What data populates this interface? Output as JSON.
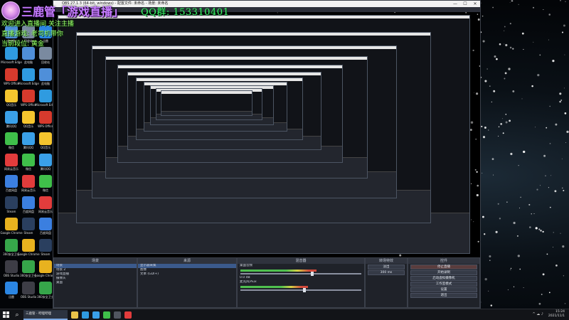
{
  "overlay": {
    "title": "三鹿管「游戏直播」",
    "qq_number": "QQ群: 153310401",
    "lines": [
      "欢迎进入直播间 关注主播",
      "直播游戏: 老司机带你",
      "当前段位: 黄金"
    ]
  },
  "desktop_icons": [
    {
      "label": "此电脑",
      "color": "#4f8fd9"
    },
    {
      "label": "Microsoft Edge",
      "color": "#2f9be0"
    },
    {
      "label": "WPS Office",
      "color": "#d63a2d"
    },
    {
      "label": "QQ音乐",
      "color": "#f5c52e"
    },
    {
      "label": "腾讯QQ",
      "color": "#3aa0e8"
    },
    {
      "label": "微信",
      "color": "#3fbf4a"
    },
    {
      "label": "网易云音乐",
      "color": "#e23c3c"
    },
    {
      "label": "百度网盘",
      "color": "#3b7fe0"
    },
    {
      "label": "Steam",
      "color": "#2a3f5f"
    },
    {
      "label": "Google Chrome",
      "color": "#e8b21f"
    },
    {
      "label": "360安全卫士",
      "color": "#36a64a"
    },
    {
      "label": "OBS Studio",
      "color": "#3d3d46"
    },
    {
      "label": "迅雷",
      "color": "#2b86e3"
    },
    {
      "label": "回收站",
      "color": "#7a8aa0"
    }
  ],
  "obs": {
    "window_title": "OBS 27.1.3 (64-bit, windows) - 配置文件: 未命名 - 场景: 未命名",
    "window_controls": {
      "minimize": "—",
      "maximize": "☐",
      "close": "✕"
    },
    "docks": {
      "scenes": {
        "header": "场景",
        "items": [
          "场景",
          "场景 2",
          "游戏直播",
          "摄像头",
          "桌面"
        ]
      },
      "sources": {
        "header": "来源",
        "items": [
          "显示器采集",
          "图像",
          "文本 (GDI+)"
        ]
      },
      "mixer": {
        "header": "混音器",
        "channels": [
          {
            "name": "桌面音频",
            "db": "0.0 dB",
            "level": 0.62
          },
          {
            "name": "麦克风/Aux",
            "db": "0.0 dB",
            "level": 0.55
          }
        ]
      },
      "transitions": {
        "header": "转场特效",
        "selected": "淡出",
        "duration": "300 ms"
      },
      "controls": {
        "header": "控件",
        "buttons": [
          "停止直播",
          "开始录制",
          "启动虚拟摄像机",
          "工作室模式",
          "设置",
          "退出"
        ]
      }
    }
  },
  "taskbar": {
    "search_glyph": "⌕",
    "active_app_label": "三鹿管 - 哔哩哔哩",
    "tray_icons": "^ ☁ ♪",
    "time": "15:24",
    "date": "2021/11/1",
    "icons": [
      {
        "name": "explorer",
        "color": "#e8c34a"
      },
      {
        "name": "edge",
        "color": "#2f9be0"
      },
      {
        "name": "qq",
        "color": "#3aa0e8"
      },
      {
        "name": "wechat",
        "color": "#3fbf4a"
      },
      {
        "name": "obs",
        "color": "#505560"
      },
      {
        "name": "netease",
        "color": "#e23c3c"
      }
    ]
  }
}
